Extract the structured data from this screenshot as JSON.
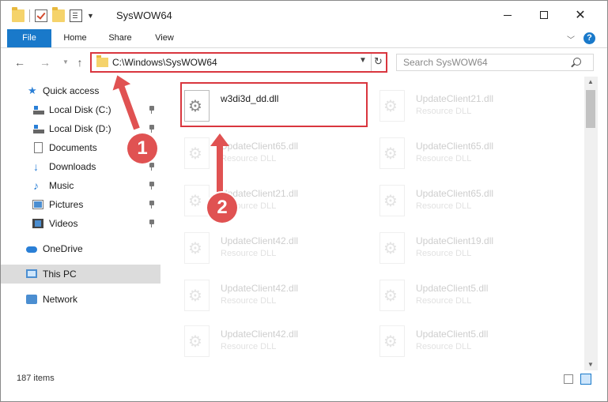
{
  "window": {
    "title": "SysWOW64"
  },
  "ribbon": {
    "tabs": [
      "File",
      "Home",
      "Share",
      "View"
    ],
    "help_label": "?"
  },
  "navigation": {
    "address": "C:\\Windows\\SysWOW64",
    "search_placeholder": "Search SysWOW64"
  },
  "sidebar": {
    "items": [
      {
        "label": "Quick access",
        "icon": "star-icon"
      },
      {
        "label": "Local Disk (C:)",
        "icon": "disk-icon",
        "pinned": true
      },
      {
        "label": "Local Disk (D:)",
        "icon": "disk-icon",
        "pinned": true
      },
      {
        "label": "Documents",
        "icon": "documents-icon",
        "pinned": true
      },
      {
        "label": "Downloads",
        "icon": "download-icon",
        "pinned": true
      },
      {
        "label": "Music",
        "icon": "music-icon",
        "pinned": true
      },
      {
        "label": "Pictures",
        "icon": "pictures-icon",
        "pinned": true
      },
      {
        "label": "Videos",
        "icon": "videos-icon",
        "pinned": true
      },
      {
        "label": "OneDrive",
        "icon": "cloud-icon"
      },
      {
        "label": "This PC",
        "icon": "computer-icon",
        "selected": true
      },
      {
        "label": "Network",
        "icon": "network-icon"
      }
    ]
  },
  "files": [
    {
      "name": "w3di3d_dd.dll",
      "type": ""
    },
    {
      "name": "UpdateClient21.dll",
      "type": "Resource DLL"
    },
    {
      "name": "UpdateClient65.dll",
      "type": "Resource DLL"
    },
    {
      "name": "UpdateClient65.dll",
      "type": "Resource DLL"
    },
    {
      "name": "UpdateClient21.dll",
      "type": "Resource DLL"
    },
    {
      "name": "UpdateClient65.dll",
      "type": "Resource DLL"
    },
    {
      "name": "UpdateClient42.dll",
      "type": "Resource DLL"
    },
    {
      "name": "UpdateClient19.dll",
      "type": "Resource DLL"
    },
    {
      "name": "UpdateClient42.dll",
      "type": "Resource DLL"
    },
    {
      "name": "UpdateClient5.dll",
      "type": "Resource DLL"
    },
    {
      "name": "UpdateClient42.dll",
      "type": "Resource DLL"
    },
    {
      "name": "UpdateClient5.dll",
      "type": "Resource DLL"
    }
  ],
  "status": {
    "item_count": "187 items"
  },
  "annotations": {
    "step1": "1",
    "step2": "2",
    "color": "#e05252"
  },
  "colors": {
    "accent": "#1979ca",
    "highlight": "#d9363e"
  }
}
